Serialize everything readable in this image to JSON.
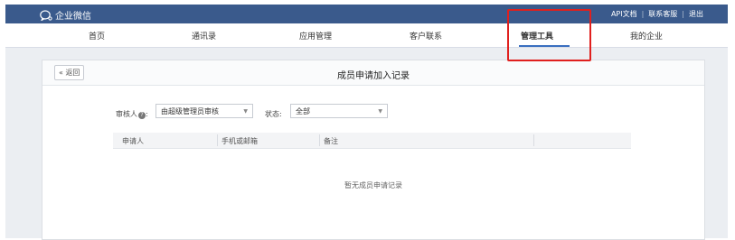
{
  "topbar": {
    "logo_text": "企业微信",
    "links": [
      "API文档",
      "联系客服",
      "退出"
    ]
  },
  "nav": {
    "items": [
      "首页",
      "通讯录",
      "应用管理",
      "客户联系",
      "管理工具",
      "我的企业"
    ],
    "active_index": 4
  },
  "page": {
    "back_label": "« 返回",
    "title": "成员申请加入记录",
    "reviewer_label": "审核人",
    "reviewer_value": "由超级管理员审核",
    "status_label": "状态:",
    "status_value": "全部",
    "columns": [
      "申请人",
      "手机或邮箱",
      "备注"
    ],
    "empty_text": "暂无成员申请记录"
  },
  "colors": {
    "topbar": "#3a5a8c",
    "highlight": "#e0201e",
    "active_underline": "#3a6fc0"
  }
}
